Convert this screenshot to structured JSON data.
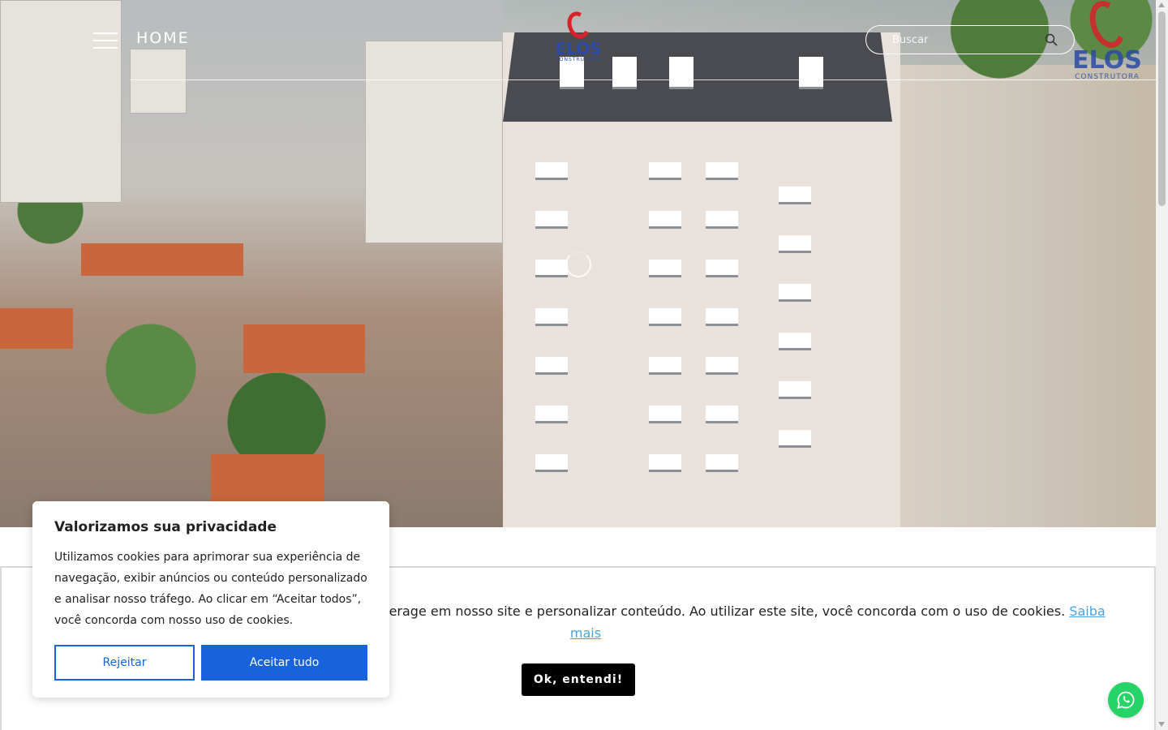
{
  "header": {
    "menu_label": "HOME",
    "logo": {
      "name": "ELOS",
      "sub": "CONSTRUTORA"
    },
    "search": {
      "placeholder": "Buscar"
    }
  },
  "cookie_bar": {
    "text_before": ", melhorar o desempenho, analisar como você interage em nosso site e personalizar conteúdo. Ao utilizar este site, você concorda com o uso de cookies.",
    "link_label": "Saiba mais",
    "ok_label": "Ok, entendi!"
  },
  "consent": {
    "title": "Valorizamos sua privacidade",
    "body": "Utilizamos cookies para aprimorar sua experiência de navegação, exibir anúncios ou conteúdo personalizado e analisar nosso tráfego. Ao clicar em “Aceitar todos”, você concorda com nosso uso de cookies.",
    "reject_label": "Rejeitar",
    "accept_label": "Aceitar tudo"
  },
  "colors": {
    "accent_blue": "#1863dc",
    "logo_red": "#d8232a",
    "logo_blue": "#2a4aa5",
    "whatsapp_green": "#25d366",
    "link_blue": "#4aa3df"
  },
  "icons": [
    "hamburger-menu-icon",
    "search-icon",
    "loading-spinner-icon",
    "whatsapp-icon"
  ]
}
